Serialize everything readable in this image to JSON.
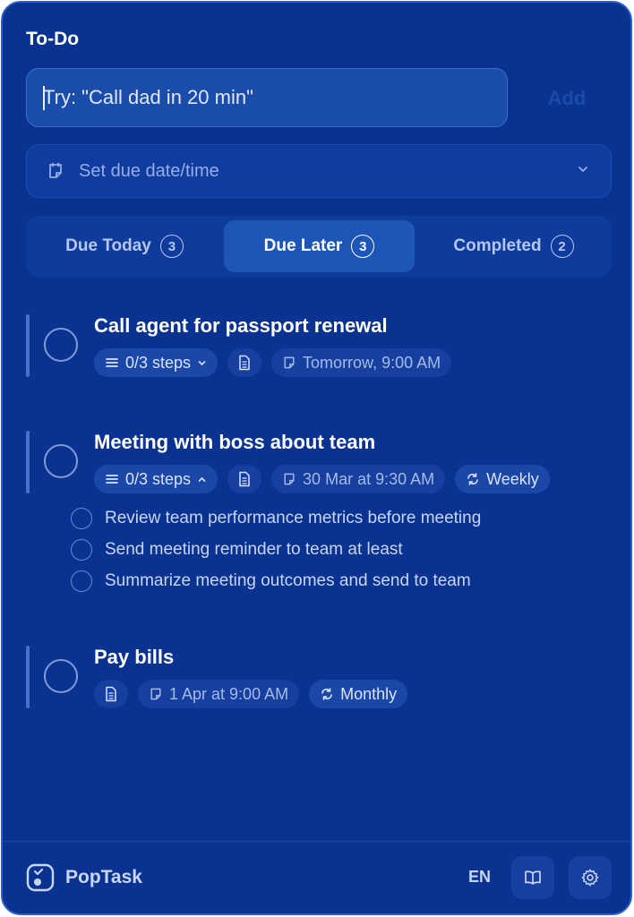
{
  "app": {
    "title": "To-Do",
    "brand": "PopTask"
  },
  "input": {
    "placeholder": "Try: \"Call dad in 20 min\"",
    "value": ""
  },
  "add_label": "Add",
  "due_select": {
    "label": "Set due date/time"
  },
  "tabs": [
    {
      "label": "Due Today",
      "count": "3",
      "active": false
    },
    {
      "label": "Due Later",
      "count": "3",
      "active": true
    },
    {
      "label": "Completed",
      "count": "2",
      "active": false
    }
  ],
  "tasks": [
    {
      "name": "Call agent for passport renewal",
      "steps": "0/3 steps",
      "due": "Tomorrow, 9:00 AM",
      "expanded": false
    },
    {
      "name": "Meeting with boss about team",
      "steps": "0/3 steps",
      "due": "30 Mar at 9:30 AM",
      "repeat": "Weekly",
      "expanded": true,
      "subtasks": [
        "Review team performance metrics before meeting",
        "Send meeting reminder to team at least",
        "Summarize meeting outcomes and send to team"
      ]
    },
    {
      "name": "Pay bills",
      "due": "1 Apr at 9:00 AM",
      "repeat": "Monthly"
    }
  ],
  "footer": {
    "language": "EN"
  },
  "colors": {
    "background": "#0a3391",
    "active_tab": "#1e56b8",
    "chip": "#163f9f"
  }
}
